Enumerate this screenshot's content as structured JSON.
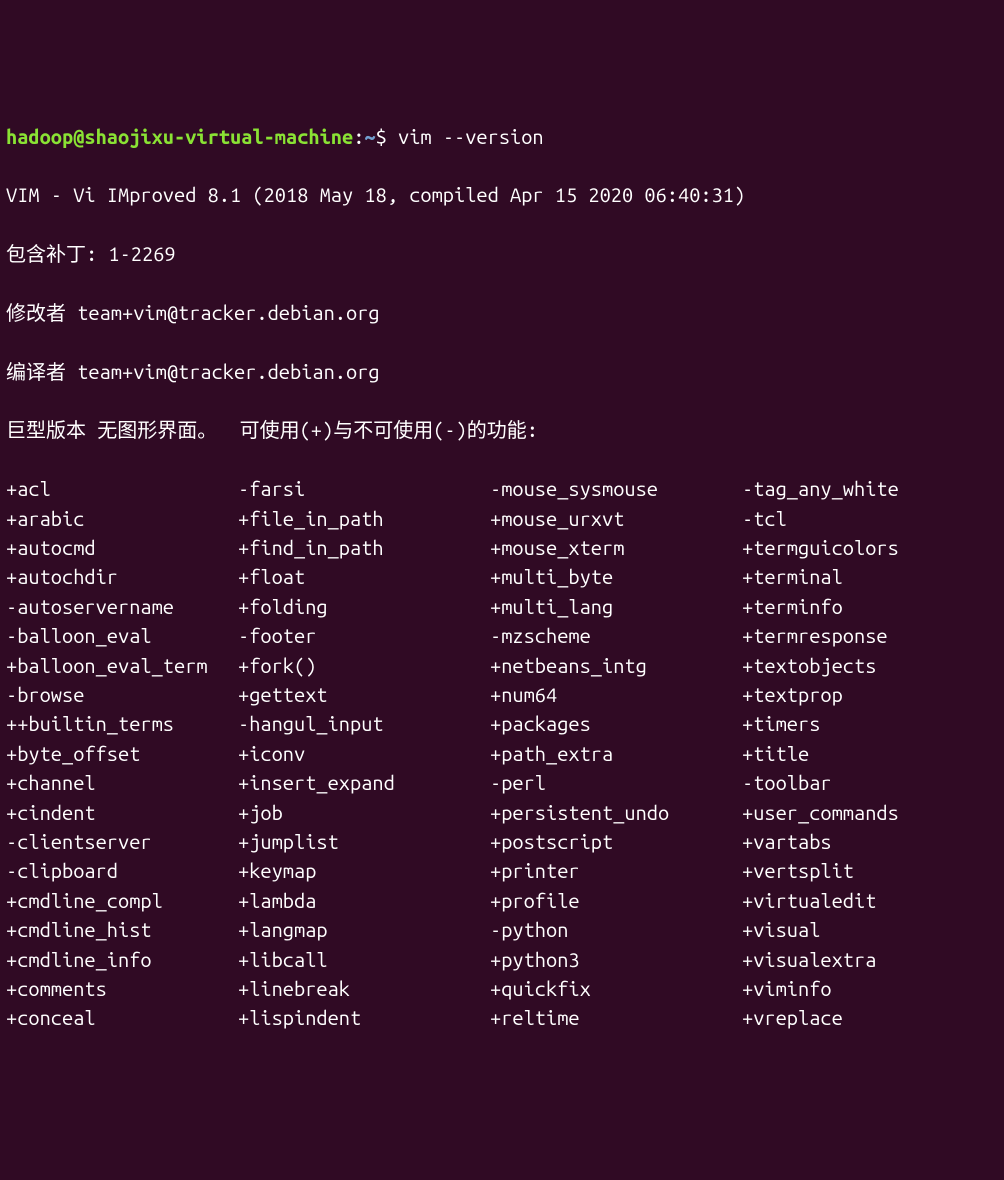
{
  "prompt": {
    "user": "hadoop",
    "at": "@",
    "host": "shaojixu-virtual-machine",
    "sep1": ":",
    "path": "~",
    "sep2": "$",
    "command": "vim --version"
  },
  "header": {
    "l1": "VIM - Vi IMproved 8.1 (2018 May 18, compiled Apr 15 2020 06:40:31)",
    "l2": "包含补丁: 1-2269",
    "l3": "修改者 team+vim@tracker.debian.org",
    "l4": "编译者 team+vim@tracker.debian.org",
    "l5": "巨型版本 无图形界面。  可使用(+)与不可使用(-)的功能:"
  },
  "features": {
    "col1": [
      "+acl",
      "+arabic",
      "+autocmd",
      "+autochdir",
      "-autoservername",
      "-balloon_eval",
      "+balloon_eval_term",
      "-browse",
      "++builtin_terms",
      "+byte_offset",
      "+channel",
      "+cindent",
      "-clientserver",
      "-clipboard",
      "+cmdline_compl",
      "+cmdline_hist",
      "+cmdline_info",
      "+comments",
      "+conceal"
    ],
    "col2": [
      "-farsi",
      "+file_in_path",
      "+find_in_path",
      "+float",
      "+folding",
      "-footer",
      "+fork()",
      "+gettext",
      "-hangul_input",
      "+iconv",
      "+insert_expand",
      "+job",
      "+jumplist",
      "+keymap",
      "+lambda",
      "+langmap",
      "+libcall",
      "+linebreak",
      "+lispindent"
    ],
    "col3": [
      "-mouse_sysmouse",
      "+mouse_urxvt",
      "+mouse_xterm",
      "+multi_byte",
      "+multi_lang",
      "-mzscheme",
      "+netbeans_intg",
      "+num64",
      "+packages",
      "+path_extra",
      "-perl",
      "+persistent_undo",
      "+postscript",
      "+printer",
      "+profile",
      "-python",
      "+python3",
      "+quickfix",
      "+reltime"
    ],
    "col4": [
      "-tag_any_white",
      "-tcl",
      "+termguicolors",
      "+terminal",
      "+terminfo",
      "+termresponse",
      "+textobjects",
      "+textprop",
      "+timers",
      "+title",
      "-toolbar",
      "+user_commands",
      "+vartabs",
      "+vertsplit",
      "+virtualedit",
      "+visual",
      "+visualextra",
      "+viminfo",
      "+vreplace"
    ]
  }
}
